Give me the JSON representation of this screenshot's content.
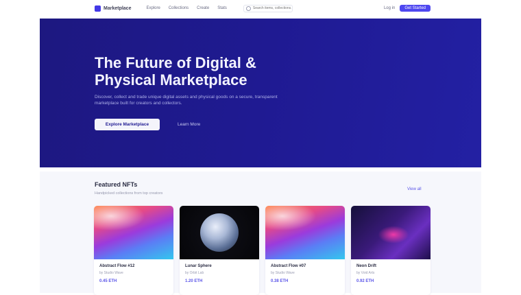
{
  "nav": {
    "logo_text": "Marketplace",
    "links": [
      "Explore",
      "Collections",
      "Create",
      "Stats"
    ],
    "search_placeholder": "Search items, collections...",
    "login_label": "Log in",
    "cta_label": "Get Started"
  },
  "hero": {
    "title": "The Future of Digital & Physical Marketplace",
    "subtitle": "Discover, collect and trade unique digital assets and physical goods on a secure, transparent marketplace built for creators and collectors.",
    "primary_cta": "Explore Marketplace",
    "secondary_cta": "Learn More"
  },
  "featured": {
    "title": "Featured NFTs",
    "subtitle": "Handpicked collections from top creators",
    "view_all": "View all",
    "cards": [
      {
        "name": "Abstract Flow #12",
        "creator": "by Studio Wave",
        "price": "0.45 ETH",
        "art": "gradient-wave"
      },
      {
        "name": "Lunar Sphere",
        "creator": "by Orbit Lab",
        "price": "1.20 ETH",
        "art": "glass-orb"
      },
      {
        "name": "Abstract Flow #07",
        "creator": "by Studio Wave",
        "price": "0.38 ETH",
        "art": "gradient-wave"
      },
      {
        "name": "Neon Drift",
        "creator": "by Void Arts",
        "price": "0.92 ETH",
        "art": "nebula"
      }
    ]
  },
  "colors": {
    "hero_bg": "#1f1a92",
    "accent": "#4e47f0",
    "section_bg": "#f6f7fc"
  }
}
